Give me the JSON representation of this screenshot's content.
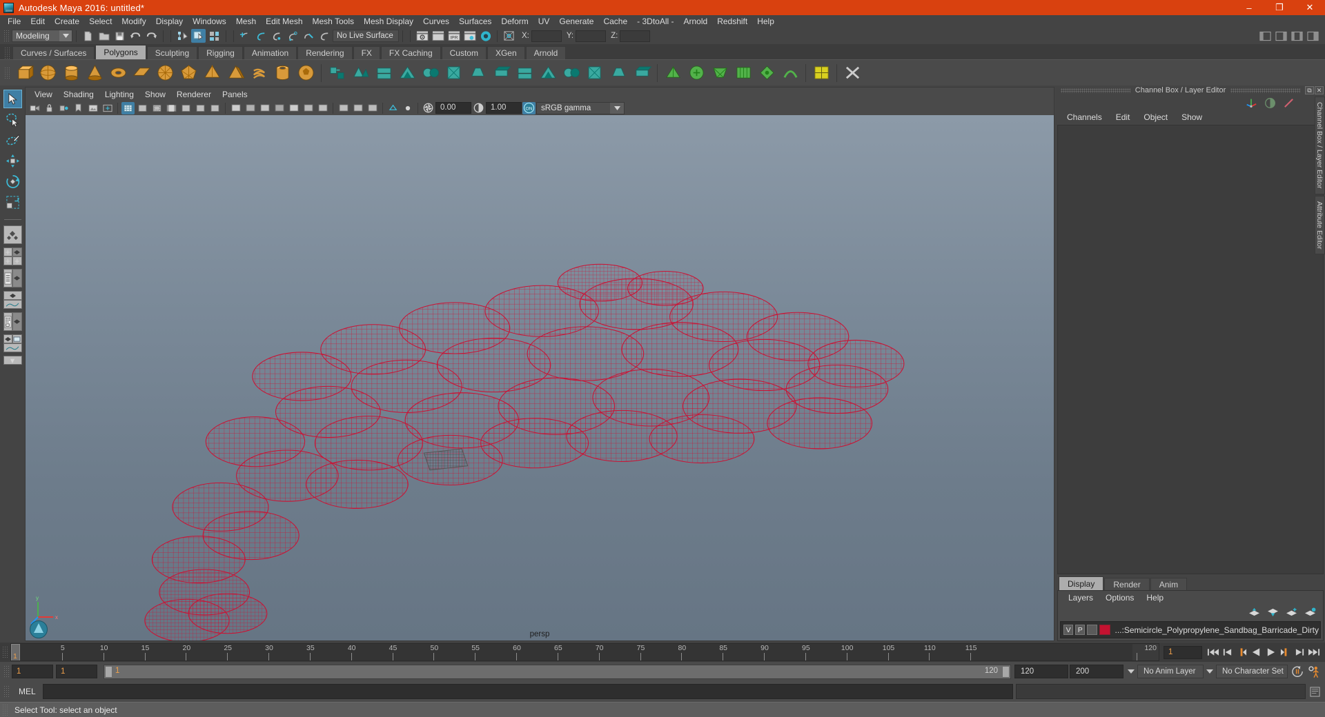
{
  "window": {
    "title": "Autodesk Maya 2016: untitled*",
    "logo_icon": "maya-logo-icon",
    "minimize_label": "–",
    "maximize_label": "❐",
    "close_label": "✕",
    "titlebar_color": "#d9410f"
  },
  "menubar": {
    "items": [
      "File",
      "Edit",
      "Create",
      "Select",
      "Modify",
      "Display",
      "Windows",
      "Mesh",
      "Edit Mesh",
      "Mesh Tools",
      "Mesh Display",
      "Curves",
      "Surfaces",
      "Deform",
      "UV",
      "Generate",
      "Cache",
      "- 3DtoAll -",
      "Arnold",
      "Redshift",
      "Help"
    ]
  },
  "statusline": {
    "mode": "Modeling",
    "live_surface": "No Live Surface",
    "axis_labels": {
      "x": "X:",
      "y": "Y:",
      "z": "Z:"
    },
    "x_value": "",
    "y_value": "",
    "z_value": "",
    "icons_left": [
      "new-scene-icon",
      "open-scene-icon",
      "save-scene-icon",
      "undo-icon",
      "redo-icon"
    ],
    "selection_mask_icons": [
      "select-by-hierarchy-icon",
      "select-by-object-type-icon",
      "select-by-component-type-icon"
    ],
    "snap_icons": [
      "snap-to-grid-icon",
      "snap-to-curve-icon",
      "snap-to-point-icon",
      "snap-to-projected-center-icon",
      "snap-to-view-plane-icon",
      "make-live-icon"
    ],
    "render_icons": [
      "render-current-frame-icon",
      "irpr-render-icon",
      "ipr-render-icon",
      "render-settings-icon",
      "hypershade-icon"
    ],
    "right_icons": [
      "show-hide-attribute-editor-icon",
      "show-hide-tool-settings-icon",
      "show-hide-channel-box-icon",
      "sidebar-toggle-icon"
    ]
  },
  "shelf": {
    "tabs": [
      "Curves / Surfaces",
      "Polygons",
      "Sculpting",
      "Rigging",
      "Animation",
      "Rendering",
      "FX",
      "FX Caching",
      "Custom",
      "XGen",
      "Arnold"
    ],
    "active_tab": "Polygons",
    "buttons": [
      {
        "name": "poly-cube-icon",
        "color": "#d89a3a"
      },
      {
        "name": "poly-sphere-icon",
        "color": "#d89a3a"
      },
      {
        "name": "poly-cylinder-icon",
        "color": "#d89a3a"
      },
      {
        "name": "poly-cone-icon",
        "color": "#d89a3a"
      },
      {
        "name": "poly-torus-icon",
        "color": "#d89a3a"
      },
      {
        "name": "poly-plane-icon",
        "color": "#d89a3a"
      },
      {
        "name": "poly-disc-icon",
        "color": "#d89a3a"
      },
      {
        "name": "poly-platonic-icon",
        "color": "#d89a3a"
      },
      {
        "name": "poly-pyramid-icon",
        "color": "#d89a3a"
      },
      {
        "name": "poly-prism-icon",
        "color": "#d89a3a"
      },
      {
        "name": "poly-helix-icon",
        "color": "#d89a3a"
      },
      {
        "name": "poly-pipe-icon",
        "color": "#d89a3a"
      },
      {
        "name": "poly-soccer-icon",
        "color": "#d89a3a"
      },
      {
        "name": "poly-combine-icon",
        "color": "#3aa9a0"
      },
      {
        "name": "poly-separate-icon",
        "color": "#3aa9a0"
      },
      {
        "name": "poly-booleans-icon",
        "color": "#3aa9a0"
      },
      {
        "name": "poly-mirror-icon",
        "color": "#3aa9a0"
      },
      {
        "name": "poly-smooth-icon",
        "color": "#3aa9a0"
      },
      {
        "name": "poly-extrude-icon",
        "color": "#3aa9a0"
      },
      {
        "name": "poly-bevel-icon",
        "color": "#3aa9a0"
      },
      {
        "name": "poly-bridge-icon",
        "color": "#3aa9a0"
      },
      {
        "name": "poly-append-icon",
        "color": "#3aa9a0"
      },
      {
        "name": "poly-wedge-icon",
        "color": "#3aa9a0"
      },
      {
        "name": "poly-duplicate-face-icon",
        "color": "#3aa9a0"
      },
      {
        "name": "poly-connect-icon",
        "color": "#3aa9a0"
      },
      {
        "name": "poly-detach-icon",
        "color": "#3aa9a0"
      },
      {
        "name": "poly-merge-icon",
        "color": "#3aa9a0"
      },
      {
        "name": "poly-crease-icon",
        "color": "#52b24a"
      },
      {
        "name": "poly-sculpt-icon",
        "color": "#52b24a"
      },
      {
        "name": "poly-multicut-icon",
        "color": "#52b24a"
      },
      {
        "name": "poly-quaddraw-icon",
        "color": "#52b24a"
      },
      {
        "name": "poly-target-weld-icon",
        "color": "#52b24a"
      },
      {
        "name": "poly-slide-edge-icon",
        "color": "#52b24a"
      },
      {
        "name": "poly-uv-icon",
        "color": "#d8d020"
      },
      {
        "name": "poly-cleanup-icon",
        "color": "#cccccc"
      }
    ]
  },
  "toolbox": {
    "tools": [
      {
        "name": "select-tool",
        "label": "Select Tool",
        "selected": true
      },
      {
        "name": "lasso-select-tool",
        "label": "Lasso Select Tool",
        "selected": false
      },
      {
        "name": "paint-select-tool",
        "label": "Paint Select Tool",
        "selected": false
      },
      {
        "name": "move-tool",
        "label": "Move Tool",
        "selected": false
      },
      {
        "name": "rotate-tool",
        "label": "Rotate Tool",
        "selected": false
      },
      {
        "name": "scale-tool",
        "label": "Scale Tool",
        "selected": false
      }
    ],
    "layouts": [
      "single-perspective-layout",
      "four-view-layout",
      "outliner-persp-layout",
      "persp-graph-layout",
      "hypershade-persp-layout",
      "persp-outliner-graph-layout"
    ],
    "more_label": "▾"
  },
  "viewport": {
    "menus": [
      "View",
      "Shading",
      "Lighting",
      "Show",
      "Renderer",
      "Panels"
    ],
    "exposure_value": "0.00",
    "gamma_value": "1.00",
    "color_management": "sRGB gamma",
    "gate_toggle_label": "ON",
    "camera_label": "persp",
    "axis_labels": {
      "y": "y",
      "x": "x",
      "z": "z"
    },
    "mesh_color": "#cc1133",
    "background_top": "#8c9aa8",
    "background_bottom": "#667584",
    "toolbar_icons": [
      "select-camera-icon",
      "lock-camera-icon",
      "camera-attributes-icon",
      "bookmark-icon",
      "image-plane-icon",
      "two-d-pan-zoom-icon",
      "grid-icon",
      "film-gate-icon",
      "resolution-gate-icon",
      "gate-mask-icon",
      "xray-icon",
      "xray-joints-icon",
      "xray-active-components-icon",
      "wireframe-icon",
      "smooth-shade-icon",
      "shaded-wireframe-icon",
      "textured-icon",
      "lights-icon",
      "shadows-icon",
      "screen-space-ao-icon",
      "motion-blur-icon",
      "multisample-icon",
      "depth-peel-icon",
      "isolate-select-icon",
      "exposure-icon",
      "gamma-icon"
    ]
  },
  "channel_box": {
    "panel_title": "Channel Box / Layer Editor",
    "float_label": "⧉",
    "close_label": "✕",
    "menus": [
      "Channels",
      "Edit",
      "Object",
      "Show"
    ],
    "header_icons": [
      "channel-box-icon",
      "attribute-editor-icon",
      "modeling-toolkit-icon"
    ],
    "content_rows": []
  },
  "layer_editor": {
    "tabs": [
      "Display",
      "Render",
      "Anim"
    ],
    "active_tab": "Display",
    "menus": [
      "Layers",
      "Options",
      "Help"
    ],
    "buttons": [
      "move-layer-up-icon",
      "move-layer-down-icon",
      "create-new-layer-icon",
      "create-layer-from-selected-icon"
    ],
    "layers": [
      {
        "visibility": "V",
        "playback": "P",
        "shading": "",
        "color": "#c41230",
        "name": "...:Semicircle_Polypropylene_Sandbag_Barricade_Dirty"
      }
    ]
  },
  "side_tabs": [
    "Channel Box / Layer Editor",
    "Attribute Editor"
  ],
  "timeline": {
    "start_frame": "1",
    "end_frame": "120",
    "current_frame": "1",
    "frame_input": "1",
    "ticks": [
      5,
      10,
      15,
      20,
      25,
      30,
      35,
      40,
      45,
      50,
      55,
      60,
      65,
      70,
      75,
      80,
      85,
      90,
      95,
      100,
      105,
      110,
      115,
      120
    ],
    "playback_buttons": [
      "go-to-start-icon",
      "step-back-keyframe-icon",
      "step-back-frame-icon",
      "play-backwards-icon",
      "play-forwards-icon",
      "step-forward-frame-icon",
      "step-forward-keyframe-icon",
      "go-to-end-icon"
    ]
  },
  "range": {
    "anim_start": "1",
    "range_start": "1",
    "slider_min_label": "1",
    "slider_max_label": "120",
    "range_end": "120",
    "anim_end": "200",
    "anim_layer": "No Anim Layer",
    "character_set": "No Character Set",
    "auto_key_icon": "auto-keyframe-icon",
    "anim_prefs_icon": "animation-preferences-icon"
  },
  "command_line": {
    "language_label": "MEL",
    "input_value": "",
    "output_value": "",
    "help_icon": "script-editor-icon"
  },
  "status_bar": {
    "message": "Select Tool: select an object"
  }
}
